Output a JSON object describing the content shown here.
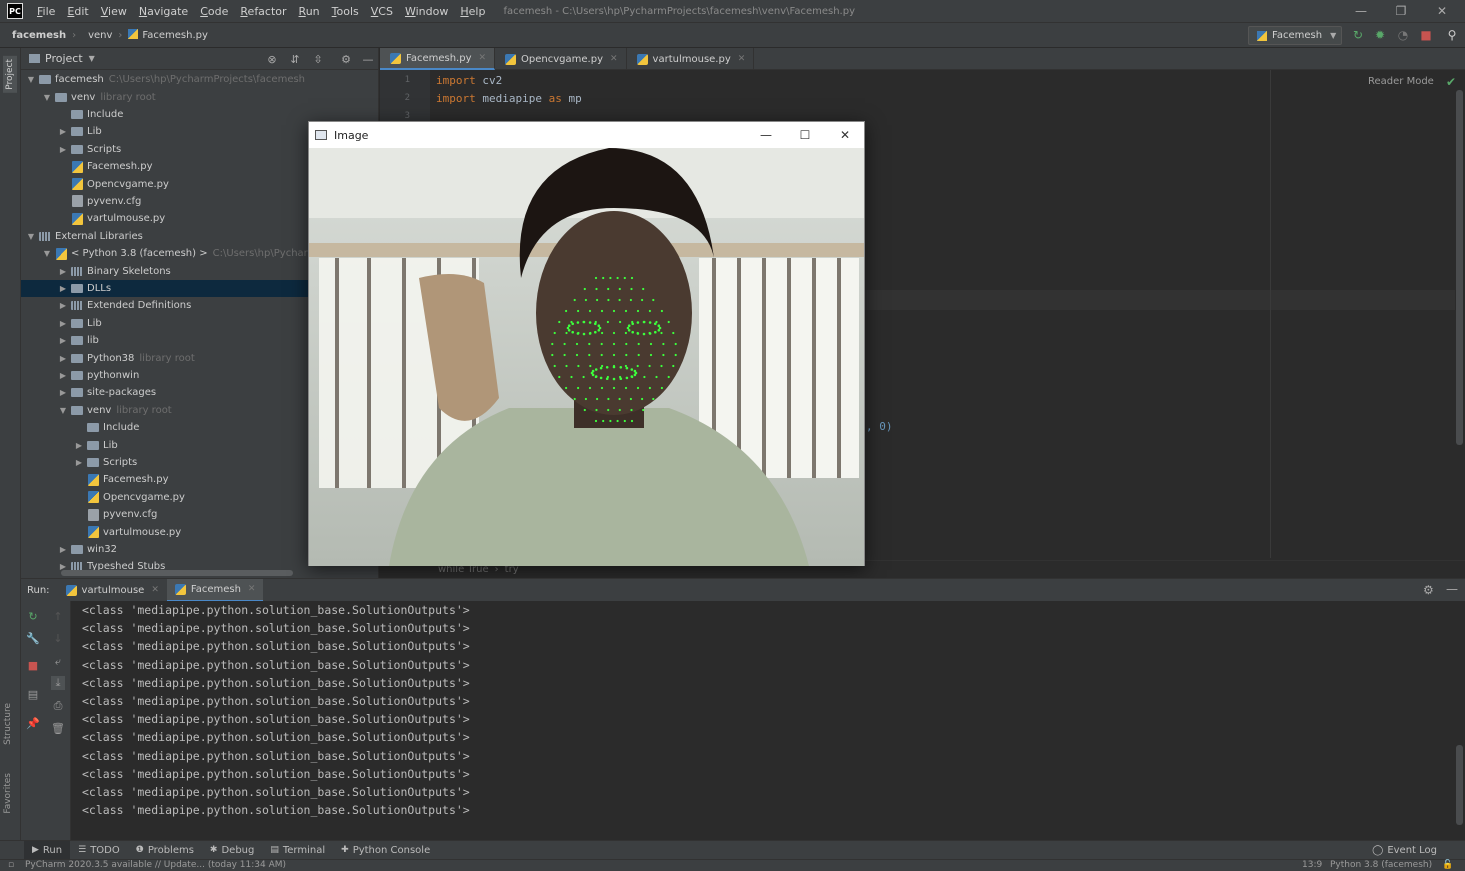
{
  "app": {
    "logo": "PC",
    "menu": [
      "File",
      "Edit",
      "View",
      "Navigate",
      "Code",
      "Refactor",
      "Run",
      "Tools",
      "VCS",
      "Window",
      "Help"
    ],
    "window_title": "facemesh - C:\\Users\\hp\\PycharmProjects\\facemesh\\venv\\Facemesh.py"
  },
  "navbar": {
    "crumbs": [
      "facemesh",
      "venv",
      "Facemesh.py"
    ],
    "run_config": "Facemesh"
  },
  "left_strip": {
    "project_tab": "Project",
    "structure_tab": "Structure",
    "favorites_tab": "Favorites"
  },
  "project": {
    "header": "Project",
    "tree": [
      {
        "label": "facemesh",
        "hint": "C:\\Users\\hp\\PycharmProjects\\facemesh",
        "type": "folder",
        "depth": 0,
        "arrow": "open"
      },
      {
        "label": "venv",
        "hint": "library root",
        "type": "folder",
        "depth": 1,
        "arrow": "open"
      },
      {
        "label": "Include",
        "hint": "",
        "type": "folder",
        "depth": 2,
        "arrow": "none"
      },
      {
        "label": "Lib",
        "hint": "",
        "type": "folder",
        "depth": 2,
        "arrow": "closed"
      },
      {
        "label": "Scripts",
        "hint": "",
        "type": "folder",
        "depth": 2,
        "arrow": "closed"
      },
      {
        "label": "Facemesh.py",
        "hint": "",
        "type": "py",
        "depth": 2,
        "arrow": "none"
      },
      {
        "label": "Opencvgame.py",
        "hint": "",
        "type": "py",
        "depth": 2,
        "arrow": "none"
      },
      {
        "label": "pyvenv.cfg",
        "hint": "",
        "type": "cfg",
        "depth": 2,
        "arrow": "none"
      },
      {
        "label": "vartulmouse.py",
        "hint": "",
        "type": "py",
        "depth": 2,
        "arrow": "none"
      },
      {
        "label": "External Libraries",
        "hint": "",
        "type": "lib",
        "depth": 0,
        "arrow": "open"
      },
      {
        "label": "< Python 3.8 (facemesh) >",
        "hint": "C:\\Users\\hp\\PycharmP",
        "type": "python",
        "depth": 1,
        "arrow": "open"
      },
      {
        "label": "Binary Skeletons",
        "hint": "",
        "type": "lib",
        "depth": 2,
        "arrow": "closed"
      },
      {
        "label": "DLLs",
        "hint": "",
        "type": "folder",
        "depth": 2,
        "arrow": "closed",
        "selected": true
      },
      {
        "label": "Extended Definitions",
        "hint": "",
        "type": "lib",
        "depth": 2,
        "arrow": "closed"
      },
      {
        "label": "Lib",
        "hint": "",
        "type": "folder",
        "depth": 2,
        "arrow": "closed"
      },
      {
        "label": "lib",
        "hint": "",
        "type": "folder",
        "depth": 2,
        "arrow": "closed"
      },
      {
        "label": "Python38",
        "hint": "library root",
        "type": "folder",
        "depth": 2,
        "arrow": "closed"
      },
      {
        "label": "pythonwin",
        "hint": "",
        "type": "folder",
        "depth": 2,
        "arrow": "closed"
      },
      {
        "label": "site-packages",
        "hint": "",
        "type": "folder",
        "depth": 2,
        "arrow": "closed"
      },
      {
        "label": "venv",
        "hint": "library root",
        "type": "folder",
        "depth": 2,
        "arrow": "open"
      },
      {
        "label": "Include",
        "hint": "",
        "type": "folder",
        "depth": 3,
        "arrow": "none"
      },
      {
        "label": "Lib",
        "hint": "",
        "type": "folder",
        "depth": 3,
        "arrow": "closed"
      },
      {
        "label": "Scripts",
        "hint": "",
        "type": "folder",
        "depth": 3,
        "arrow": "closed"
      },
      {
        "label": "Facemesh.py",
        "hint": "",
        "type": "py",
        "depth": 3,
        "arrow": "none"
      },
      {
        "label": "Opencvgame.py",
        "hint": "",
        "type": "py",
        "depth": 3,
        "arrow": "none"
      },
      {
        "label": "pyvenv.cfg",
        "hint": "",
        "type": "cfg",
        "depth": 3,
        "arrow": "none"
      },
      {
        "label": "vartulmouse.py",
        "hint": "",
        "type": "py",
        "depth": 3,
        "arrow": "none"
      },
      {
        "label": "win32",
        "hint": "",
        "type": "folder",
        "depth": 2,
        "arrow": "closed"
      },
      {
        "label": "Typeshed Stubs",
        "hint": "",
        "type": "lib",
        "depth": 2,
        "arrow": "closed"
      }
    ]
  },
  "editor": {
    "tabs": [
      {
        "label": "Facemesh.py",
        "active": true
      },
      {
        "label": "Opencvgame.py",
        "active": false
      },
      {
        "label": "vartulmouse.py",
        "active": false
      }
    ],
    "lines": [
      {
        "no": "1",
        "kw": "import",
        "rest": " cv2"
      },
      {
        "no": "2",
        "kw": "import",
        "rest": " mediapipe ",
        "kw2": "as",
        "rest2": " mp"
      },
      {
        "no": "3",
        "kw": "",
        "rest": ""
      }
    ],
    "reader_mode": "Reader Mode",
    "code_fragment": ", 0)",
    "breadcrumbs": [
      "while True",
      "try"
    ]
  },
  "cv_window": {
    "title": "Image",
    "minimize": "—",
    "maximize": "☐",
    "close": "✕"
  },
  "run_panel": {
    "label": "Run:",
    "tabs": [
      {
        "label": "vartulmouse",
        "active": false
      },
      {
        "label": "Facemesh",
        "active": true
      }
    ],
    "output_line": "<class 'mediapipe.python.solution_base.SolutionOutputs'>",
    "output_count": 12
  },
  "bottom_tabs": [
    {
      "label": "Run",
      "icon": "▶",
      "active": true
    },
    {
      "label": "TODO",
      "icon": "☰",
      "active": false
    },
    {
      "label": "Problems",
      "icon": "❶",
      "active": false
    },
    {
      "label": "Debug",
      "icon": "✱",
      "active": false
    },
    {
      "label": "Terminal",
      "icon": "▤",
      "active": false
    },
    {
      "label": "Python Console",
      "icon": "✚",
      "active": false
    }
  ],
  "event_log": "Event Log",
  "status": {
    "message": "PyCharm 2020.3.5 available // Update... (today 11:34 AM)",
    "position": "13:9",
    "interpreter": "Python 3.8 (facemesh)"
  },
  "colors": {
    "accent": "#4a88c7",
    "selection": "#0d293e",
    "keyword": "#cc7832",
    "mesh": "#3cff3c"
  }
}
